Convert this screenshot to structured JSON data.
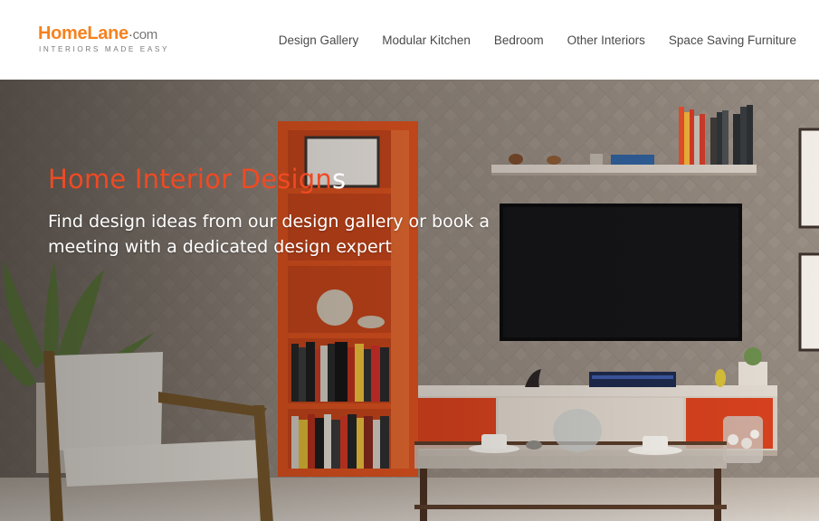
{
  "header": {
    "logo": {
      "home": "Home",
      "lane": "Lane",
      "dot": "·",
      "com": "com",
      "tagline": "INTERIORS MADE EASY"
    },
    "nav": [
      {
        "label": "Design Gallery"
      },
      {
        "label": "Modular Kitchen"
      },
      {
        "label": "Bedroom"
      },
      {
        "label": "Other Interiors"
      },
      {
        "label": "Space Saving Furniture"
      }
    ]
  },
  "hero": {
    "title_accent": "Home Interior Design",
    "title_rest": "s",
    "subtitle": "Find design ideas from our design gallery or book a meeting with a dedicated design expert"
  },
  "colors": {
    "brand_orange": "#f58220",
    "accent_red": "#ef4a23",
    "nav_text": "#4a4a4a"
  }
}
